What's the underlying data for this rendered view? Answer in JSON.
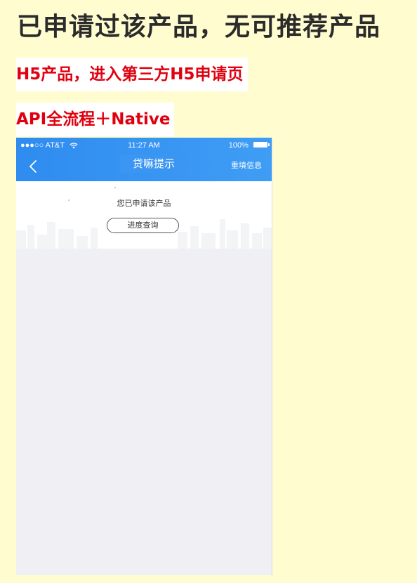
{
  "heading": "已申请过该产品，无可推荐产品",
  "notes": {
    "h5": "H5产品，进入第三方H5申请页",
    "api": "API全流程＋Native"
  },
  "phone": {
    "status_bar": {
      "carrier": "●●●○○ AT&T",
      "time": "11:27 AM",
      "battery": "100%"
    },
    "nav": {
      "title": "贷嘛提示",
      "right_action": "重填信息"
    },
    "content": {
      "message": "您已申请该产品",
      "progress_button": "进度查询"
    }
  },
  "colors": {
    "page_background": "#fffdd0",
    "nav_blue": "#2f8cf0",
    "note_red": "#e0000f"
  },
  "icons": [
    "back-icon",
    "wifi-icon",
    "battery-icon"
  ]
}
